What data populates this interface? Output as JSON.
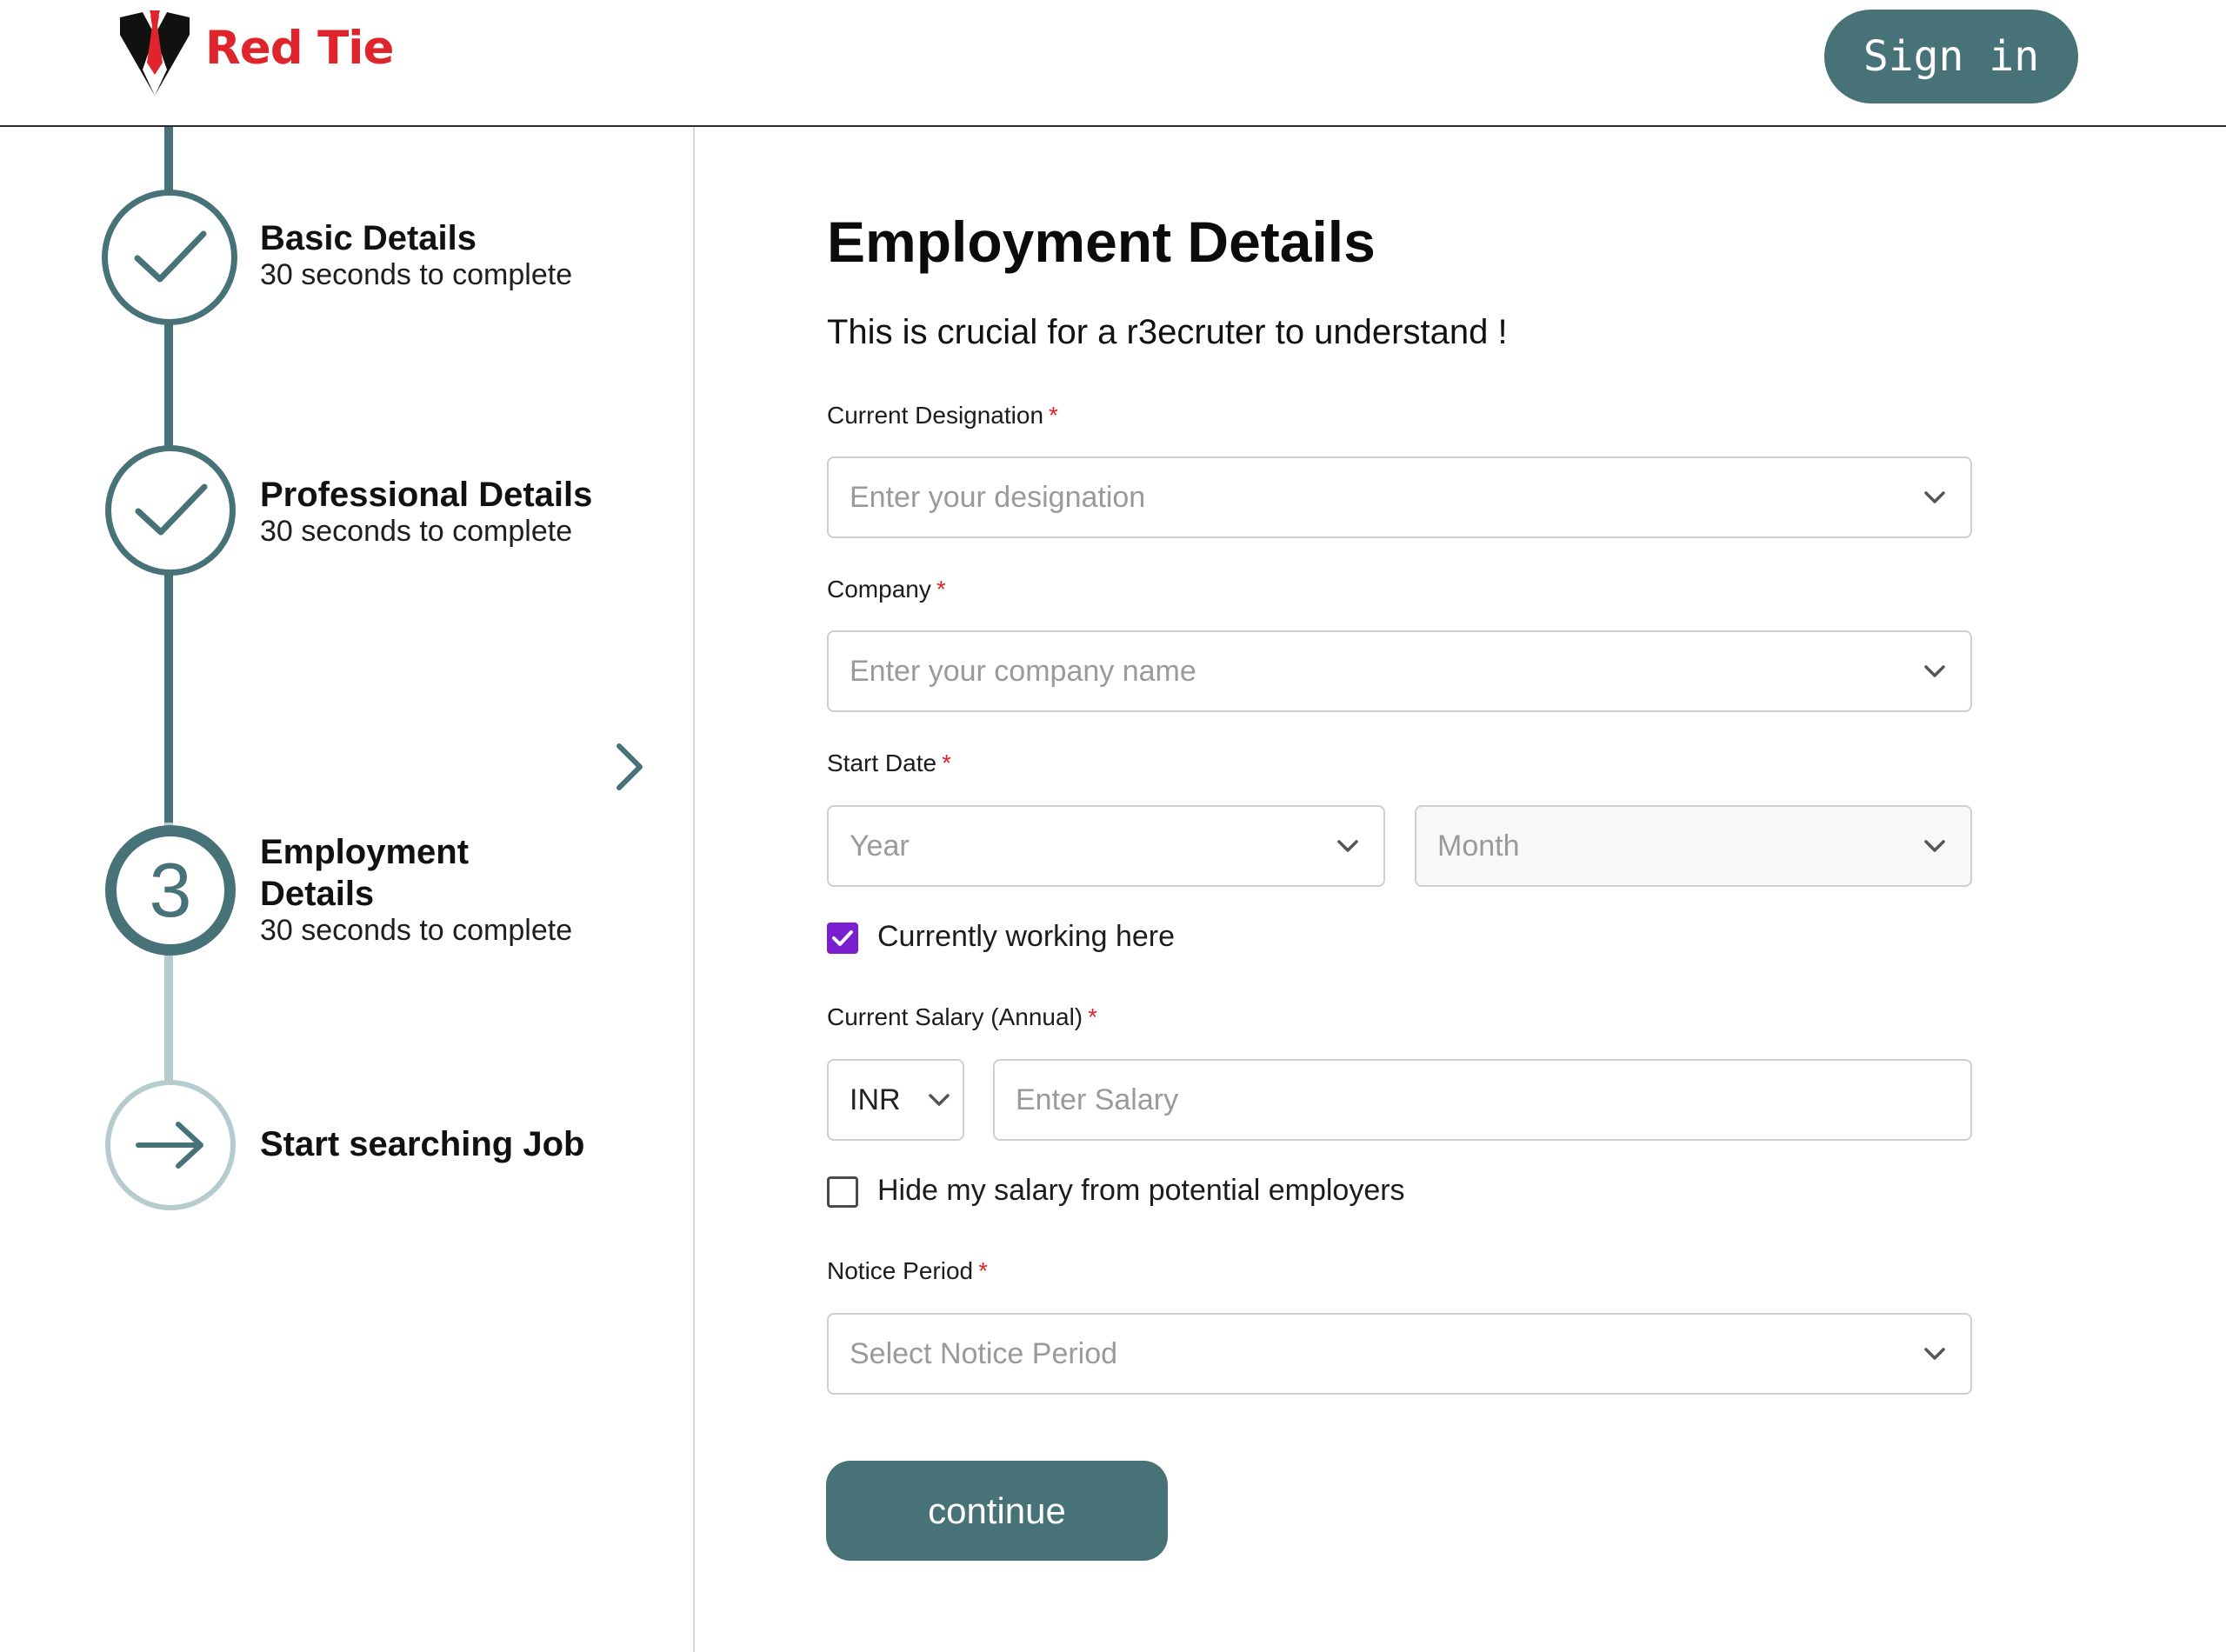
{
  "header": {
    "brand": "Red Tie",
    "sign_in_label": "Sign in"
  },
  "steps": [
    {
      "title": "Basic Details",
      "subtitle": "30 seconds to complete",
      "state": "completed",
      "icon": "check-icon"
    },
    {
      "title": "Professional Details",
      "subtitle": "30 seconds to complete",
      "state": "completed",
      "icon": "check-icon"
    },
    {
      "title_line1": "Employment",
      "title_line2": "Details",
      "subtitle": "30 seconds to complete",
      "state": "current",
      "number": "3"
    },
    {
      "title": "Start searching Job",
      "state": "upcoming",
      "icon": "arrow-right-icon"
    }
  ],
  "form": {
    "title": "Employment Details",
    "subtitle": "This is crucial for a r3ecruter to understand !",
    "designation": {
      "label": "Current Designation",
      "required_mark": "*",
      "placeholder": "Enter your designation"
    },
    "company": {
      "label": "Company",
      "required_mark": "*",
      "placeholder": "Enter your company name"
    },
    "start_date": {
      "label": "Start Date",
      "required_mark": "*",
      "year_placeholder": "Year",
      "month_placeholder": "Month"
    },
    "currently_working": {
      "label": "Currently working here",
      "checked": true
    },
    "salary": {
      "label": "Current Salary (Annual)",
      "required_mark": "*",
      "currency": "INR",
      "placeholder": "Enter Salary"
    },
    "hide_salary": {
      "label": "Hide my salary from potential employers",
      "checked": false
    },
    "notice_period": {
      "label": "Notice Period",
      "required_mark": "*",
      "placeholder": "Select Notice Period"
    },
    "continue_label": "continue"
  },
  "colors": {
    "brand_red": "#e0242b",
    "accent_teal": "#477278",
    "checkbox_purple": "#7a1fd0",
    "track_light": "#b6cbcd"
  }
}
